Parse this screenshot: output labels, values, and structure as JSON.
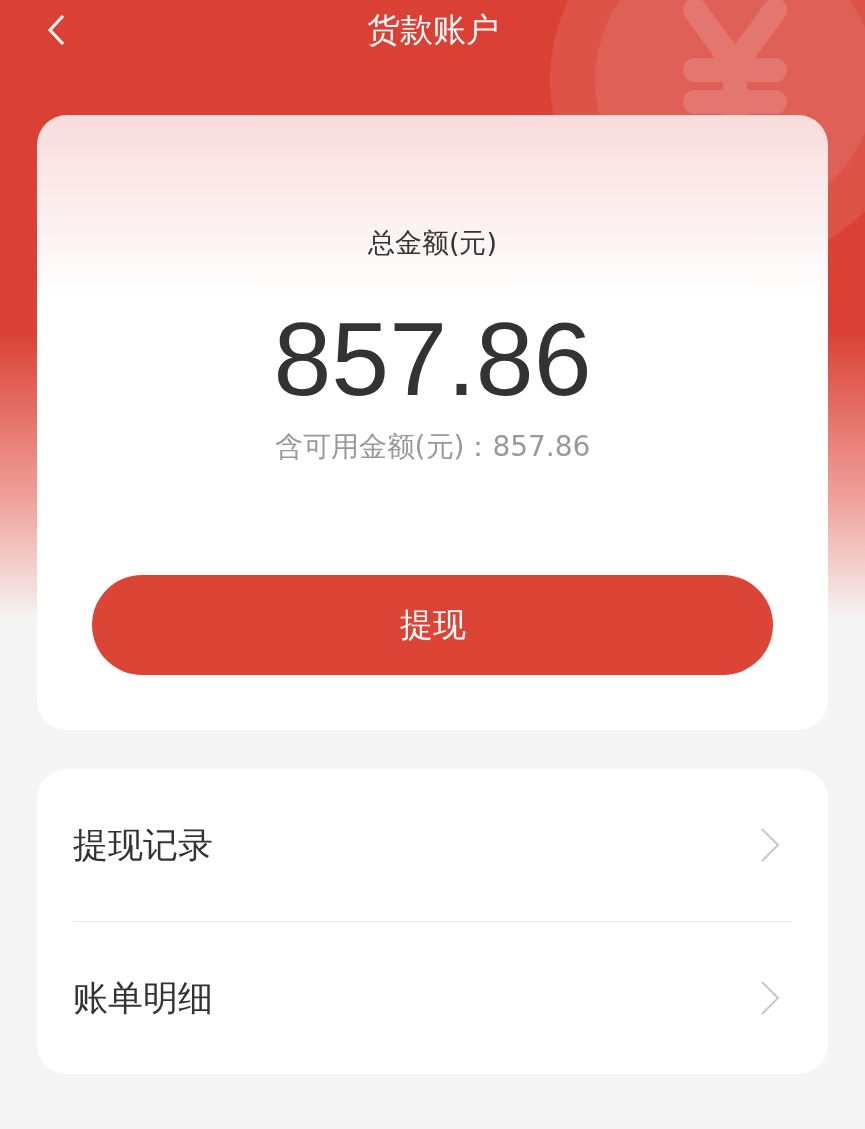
{
  "header": {
    "title": "货款账户"
  },
  "balance": {
    "label": "总金额(元)",
    "amount": "857.86",
    "available": "含可用金额(元)：857.86",
    "button": "提现"
  },
  "menu": [
    {
      "label": "提现记录"
    },
    {
      "label": "账单明细"
    }
  ]
}
